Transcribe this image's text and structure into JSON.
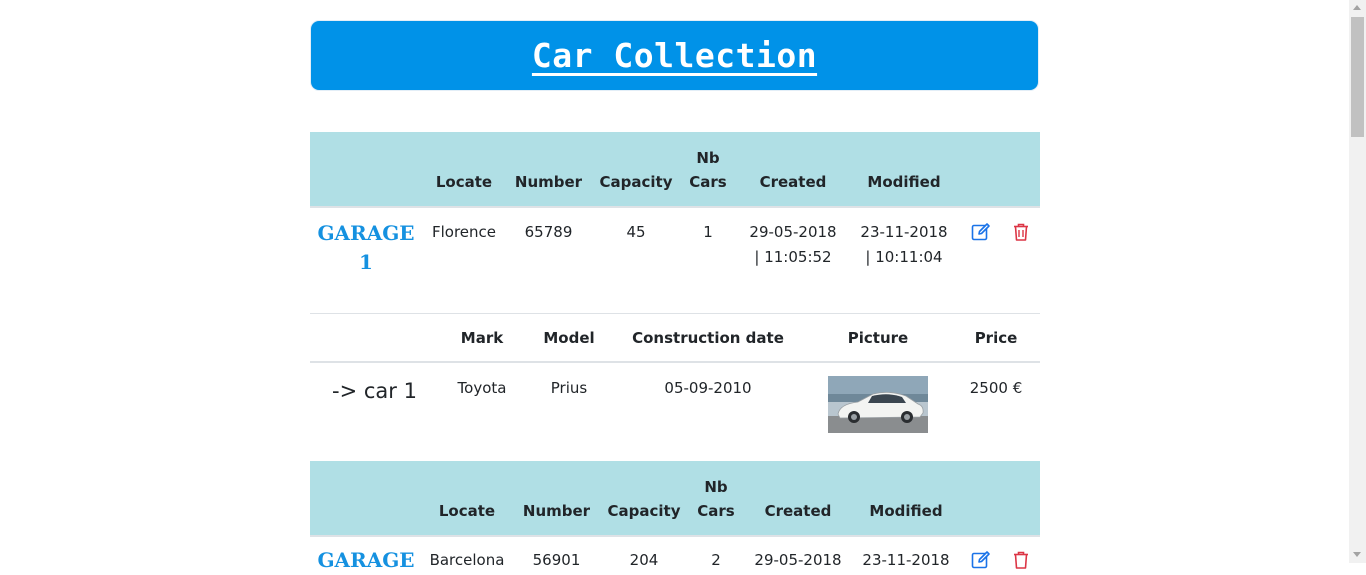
{
  "banner": {
    "title": "Car Collection"
  },
  "garage_headers": {
    "locate": "Locate",
    "number": "Number",
    "capacity": "Capacity",
    "nb_line1": "Nb",
    "nb_line2": "Cars",
    "created": "Created",
    "modified": "Modified"
  },
  "car_headers": {
    "mark": "Mark",
    "model": "Model",
    "construction": "Construction date",
    "picture": "Picture",
    "price": "Price"
  },
  "garages": [
    {
      "name_line1": "GARAGE",
      "name_line2": "1",
      "locate": "Florence",
      "number": "65789",
      "capacity": "45",
      "nb_cars": "1",
      "created_date": "29-05-2018",
      "created_time": "| 11:05:52",
      "modified_date": "23-11-2018",
      "modified_time": "| 10:11:04",
      "cars": [
        {
          "name": "-> car 1",
          "mark": "Toyota",
          "model": "Prius",
          "construction": "05-09-2010",
          "price": "2500 €"
        }
      ]
    },
    {
      "name_line1": "GARAGE",
      "locate": "Barcelona",
      "number": "56901",
      "capacity": "204",
      "nb_cars": "2",
      "created_date": "29-05-2018",
      "modified_date": "23-11-2018"
    }
  ],
  "icons": {
    "edit": "edit-icon",
    "delete": "trash-icon"
  },
  "colors": {
    "banner": "#0092e8",
    "header_bg": "#b0dfe5",
    "link": "#1591e0",
    "edit": "#1a73e8",
    "delete": "#dc3545"
  }
}
